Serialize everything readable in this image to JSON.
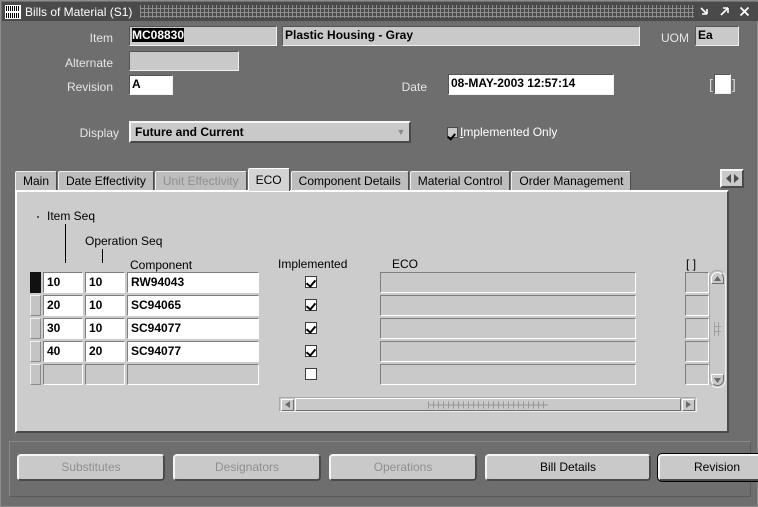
{
  "window": {
    "title": "Bills of Material (S1)",
    "icon": "application-icon",
    "controls": {
      "minimize": "minimize-icon",
      "maximize": "maximize-icon",
      "close": "close-icon"
    }
  },
  "header": {
    "item_label": "Item",
    "item_value": "MC08830",
    "description_value": "Plastic Housing  - Gray",
    "uom_label": "UOM",
    "uom_value": "Ea",
    "alternate_label": "Alternate",
    "alternate_value": "",
    "revision_label": "Revision",
    "revision_value": "A",
    "date_label": "Date",
    "date_value": "08-MAY-2003 12:57:14",
    "flex_open": "[",
    "flex_close": "]",
    "flex_value": ""
  },
  "display": {
    "label": "Display",
    "value": "Future and Current",
    "arrow": "chevron-down-icon",
    "implemented_only_label_pre": "",
    "implemented_only_mnemonic": "I",
    "implemented_only_label_post": "mplemented Only",
    "implemented_only_checked": true
  },
  "tabs": [
    {
      "label": "Main",
      "state": "enabled"
    },
    {
      "label": "Date Effectivity",
      "state": "enabled"
    },
    {
      "label": "Unit Effectivity",
      "state": "disabled"
    },
    {
      "label": "ECO",
      "state": "active"
    },
    {
      "label": "Component Details",
      "state": "enabled"
    },
    {
      "label": "Material Control",
      "state": "enabled"
    },
    {
      "label": "Order Management",
      "state": "enabled"
    }
  ],
  "grid": {
    "headers": {
      "item_seq": "Item Seq",
      "operation_seq": "Operation Seq",
      "component": "Component",
      "implemented": "Implemented",
      "eco": "ECO",
      "flex_open": "[",
      "flex_close": "]"
    },
    "rows": [
      {
        "current": true,
        "item_seq": "10",
        "operation_seq": "10",
        "component": "RW94043",
        "implemented": true,
        "eco": "",
        "flex": ""
      },
      {
        "current": false,
        "item_seq": "20",
        "operation_seq": "10",
        "component": "SC94065",
        "implemented": true,
        "eco": "",
        "flex": ""
      },
      {
        "current": false,
        "item_seq": "30",
        "operation_seq": "10",
        "component": "SC94077",
        "implemented": true,
        "eco": "",
        "flex": ""
      },
      {
        "current": false,
        "item_seq": "40",
        "operation_seq": "20",
        "component": "SC94077",
        "implemented": true,
        "eco": "",
        "flex": ""
      },
      {
        "current": false,
        "item_seq": "",
        "operation_seq": "",
        "component": "",
        "implemented": false,
        "eco": "",
        "flex": ""
      }
    ]
  },
  "scrollbars": {
    "v_up": "scroll-up-icon",
    "v_down": "scroll-down-icon",
    "h_left": "scroll-left-icon",
    "h_right": "scroll-right-icon"
  },
  "tabnav": {
    "left": "tab-scroll-left-icon",
    "right": "tab-scroll-right-icon"
  },
  "buttons": [
    {
      "label": "Substitutes",
      "mnemonic": "b",
      "state": "disabled"
    },
    {
      "label": "Designators",
      "mnemonic": "D",
      "state": "disabled"
    },
    {
      "label": "Operations",
      "mnemonic": "",
      "state": "disabled"
    },
    {
      "label": "Bill Details",
      "mnemonic": "i",
      "state": "enabled"
    },
    {
      "label": "Revision",
      "mnemonic": "R",
      "state": "focused"
    }
  ]
}
